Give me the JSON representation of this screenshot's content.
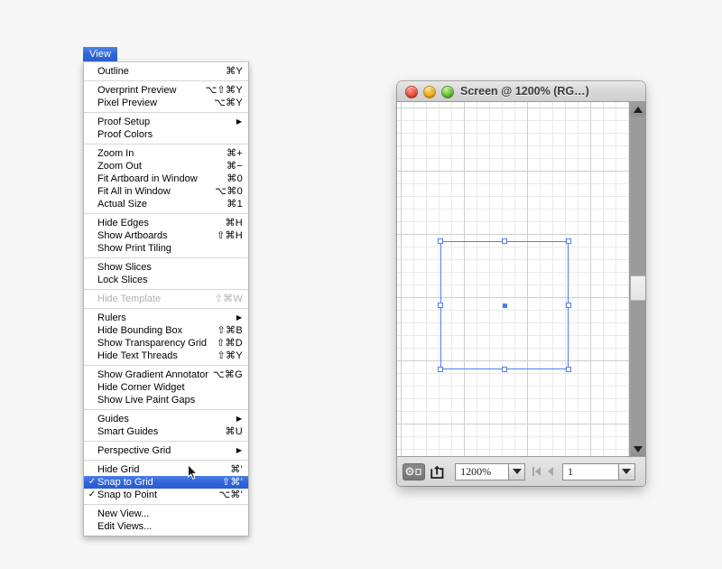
{
  "menubar": {
    "view_label": "View"
  },
  "menu": {
    "groups": [
      {
        "items": [
          {
            "label": "Outline",
            "shortcut": "⌘Y",
            "check": "",
            "arrow": false,
            "disabled": false,
            "selected": false
          }
        ]
      },
      {
        "items": [
          {
            "label": "Overprint Preview",
            "shortcut": "⌥⇧⌘Y",
            "check": "",
            "arrow": false,
            "disabled": false,
            "selected": false
          },
          {
            "label": "Pixel Preview",
            "shortcut": "⌥⌘Y",
            "check": "",
            "arrow": false,
            "disabled": false,
            "selected": false
          }
        ]
      },
      {
        "items": [
          {
            "label": "Proof Setup",
            "shortcut": "",
            "check": "",
            "arrow": true,
            "disabled": false,
            "selected": false
          },
          {
            "label": "Proof Colors",
            "shortcut": "",
            "check": "",
            "arrow": false,
            "disabled": false,
            "selected": false
          }
        ]
      },
      {
        "items": [
          {
            "label": "Zoom In",
            "shortcut": "⌘+",
            "check": "",
            "arrow": false,
            "disabled": false,
            "selected": false
          },
          {
            "label": "Zoom Out",
            "shortcut": "⌘−",
            "check": "",
            "arrow": false,
            "disabled": false,
            "selected": false
          },
          {
            "label": "Fit Artboard in Window",
            "shortcut": "⌘0",
            "check": "",
            "arrow": false,
            "disabled": false,
            "selected": false
          },
          {
            "label": "Fit All in Window",
            "shortcut": "⌥⌘0",
            "check": "",
            "arrow": false,
            "disabled": false,
            "selected": false
          },
          {
            "label": "Actual Size",
            "shortcut": "⌘1",
            "check": "",
            "arrow": false,
            "disabled": false,
            "selected": false
          }
        ]
      },
      {
        "items": [
          {
            "label": "Hide Edges",
            "shortcut": "⌘H",
            "check": "",
            "arrow": false,
            "disabled": false,
            "selected": false
          },
          {
            "label": "Show Artboards",
            "shortcut": "⇧⌘H",
            "check": "",
            "arrow": false,
            "disabled": false,
            "selected": false
          },
          {
            "label": "Show Print Tiling",
            "shortcut": "",
            "check": "",
            "arrow": false,
            "disabled": false,
            "selected": false
          }
        ]
      },
      {
        "items": [
          {
            "label": "Show Slices",
            "shortcut": "",
            "check": "",
            "arrow": false,
            "disabled": false,
            "selected": false
          },
          {
            "label": "Lock Slices",
            "shortcut": "",
            "check": "",
            "arrow": false,
            "disabled": false,
            "selected": false
          }
        ]
      },
      {
        "items": [
          {
            "label": "Hide Template",
            "shortcut": "⇧⌘W",
            "check": "",
            "arrow": false,
            "disabled": true,
            "selected": false
          }
        ]
      },
      {
        "items": [
          {
            "label": "Rulers",
            "shortcut": "",
            "check": "",
            "arrow": true,
            "disabled": false,
            "selected": false
          },
          {
            "label": "Hide Bounding Box",
            "shortcut": "⇧⌘B",
            "check": "",
            "arrow": false,
            "disabled": false,
            "selected": false
          },
          {
            "label": "Show Transparency Grid",
            "shortcut": "⇧⌘D",
            "check": "",
            "arrow": false,
            "disabled": false,
            "selected": false
          },
          {
            "label": "Hide Text Threads",
            "shortcut": "⇧⌘Y",
            "check": "",
            "arrow": false,
            "disabled": false,
            "selected": false
          }
        ]
      },
      {
        "items": [
          {
            "label": "Show Gradient Annotator",
            "shortcut": "⌥⌘G",
            "check": "",
            "arrow": false,
            "disabled": false,
            "selected": false
          },
          {
            "label": "Hide Corner Widget",
            "shortcut": "",
            "check": "",
            "arrow": false,
            "disabled": false,
            "selected": false
          },
          {
            "label": "Show Live Paint Gaps",
            "shortcut": "",
            "check": "",
            "arrow": false,
            "disabled": false,
            "selected": false
          }
        ]
      },
      {
        "items": [
          {
            "label": "Guides",
            "shortcut": "",
            "check": "",
            "arrow": true,
            "disabled": false,
            "selected": false
          },
          {
            "label": "Smart Guides",
            "shortcut": "⌘U",
            "check": "",
            "arrow": false,
            "disabled": false,
            "selected": false
          }
        ]
      },
      {
        "items": [
          {
            "label": "Perspective Grid",
            "shortcut": "",
            "check": "",
            "arrow": true,
            "disabled": false,
            "selected": false
          }
        ]
      },
      {
        "items": [
          {
            "label": "Hide Grid",
            "shortcut": "⌘'",
            "check": "",
            "arrow": false,
            "disabled": false,
            "selected": false
          },
          {
            "label": "Snap to Grid",
            "shortcut": "⇧⌘'",
            "check": "✓",
            "arrow": false,
            "disabled": false,
            "selected": true
          },
          {
            "label": "Snap to Point",
            "shortcut": "⌥⌘'",
            "check": "✓",
            "arrow": false,
            "disabled": false,
            "selected": false
          }
        ]
      },
      {
        "items": [
          {
            "label": "New View...",
            "shortcut": "",
            "check": "",
            "arrow": false,
            "disabled": false,
            "selected": false
          },
          {
            "label": "Edit Views...",
            "shortcut": "",
            "check": "",
            "arrow": false,
            "disabled": false,
            "selected": false
          }
        ]
      }
    ]
  },
  "window": {
    "title": "Screen @ 1200% (RG…)",
    "traffic_lights": [
      "close",
      "minimize",
      "zoom"
    ]
  },
  "statusbar": {
    "zoom_value": "1200%",
    "page_value": "1",
    "icons": [
      "artboard-tool-icon",
      "share-icon",
      "first-page-icon",
      "previous-page-icon"
    ]
  },
  "colors": {
    "menu_highlight": "#2f63d8",
    "selection_blue": "#4f7fe8",
    "grid_minor": "#eaeaea",
    "grid_major": "#cfcfcf",
    "page_background": "#f7f7f7"
  },
  "canvas": {
    "selection": {
      "handles": [
        "top-left",
        "top-center",
        "top-right",
        "middle-left",
        "middle-right",
        "bottom-left",
        "bottom-center",
        "bottom-right"
      ],
      "center_point": true
    }
  }
}
